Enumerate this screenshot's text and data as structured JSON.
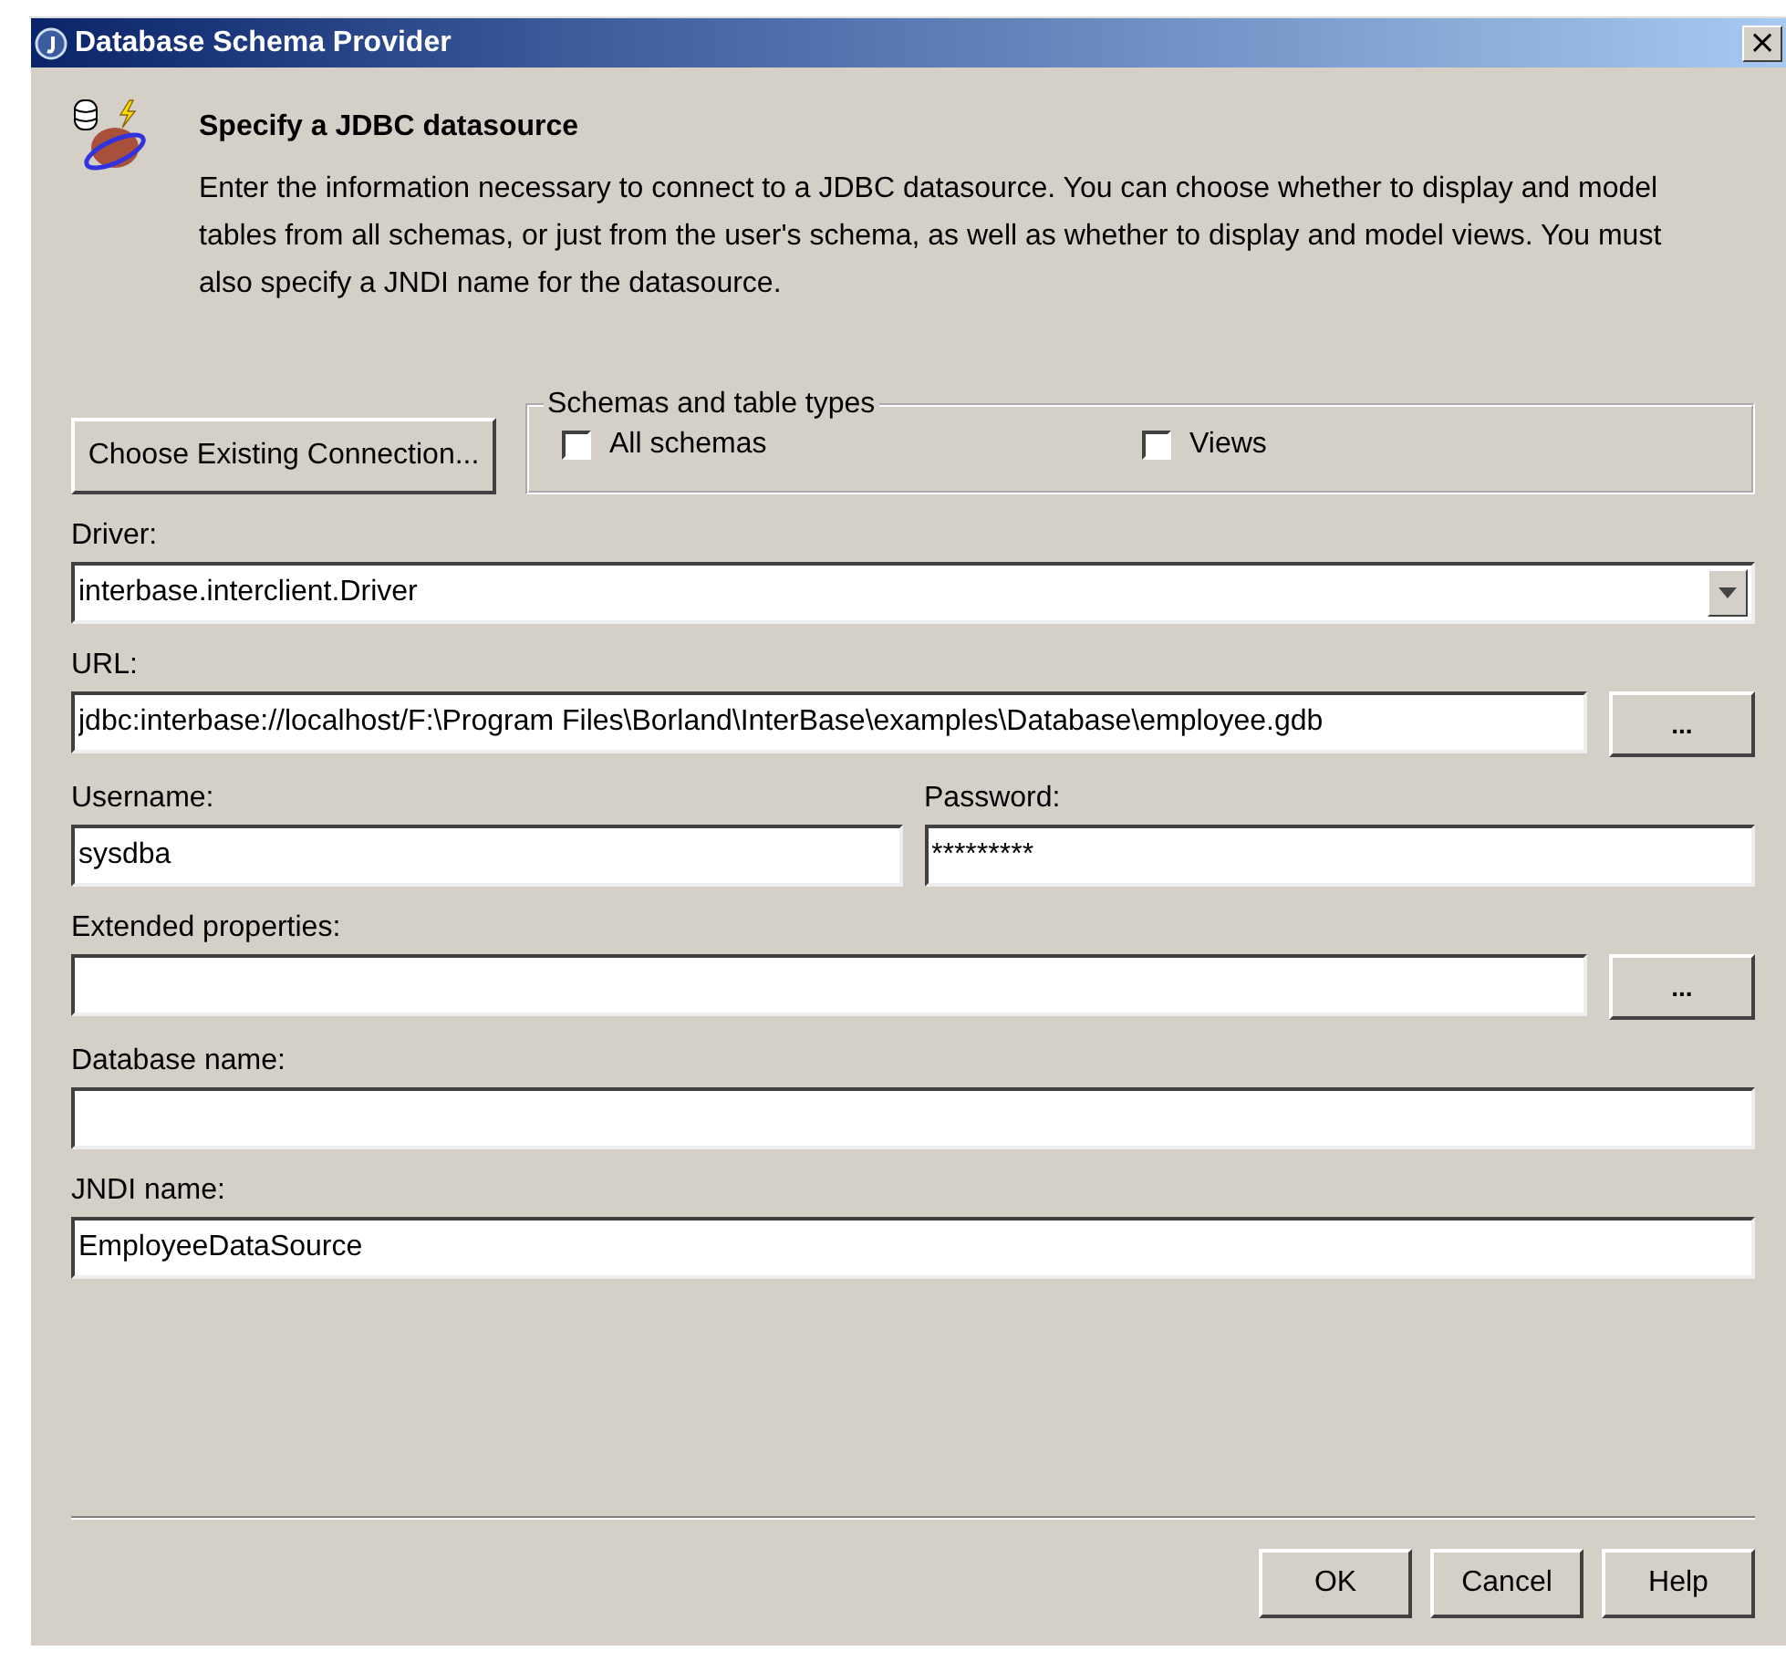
{
  "window": {
    "title": "Database Schema Provider",
    "close_label": "×"
  },
  "header": {
    "title": "Specify a JDBC datasource",
    "description": "Enter the information necessary to connect to a JDBC datasource. You can choose whether to display and model tables from all schemas, or just from the user's schema, as well as whether to display and model views.  You must also specify a JNDI name for the datasource."
  },
  "choose_button": "Choose Existing Connection...",
  "schemas_group": {
    "title": "Schemas and table types",
    "options": [
      {
        "label": "All schemas",
        "checked": false
      },
      {
        "label": "Views",
        "checked": false
      }
    ]
  },
  "driver": {
    "label": "Driver:",
    "value": "interbase.interclient.Driver"
  },
  "url": {
    "label": "URL:",
    "value": "jdbc:interbase://localhost/F:\\Program Files\\Borland\\InterBase\\examples\\Database\\employee.gdb",
    "button": "..."
  },
  "username": {
    "label": "Username:",
    "value": "sysdba"
  },
  "password": {
    "label": "Password:",
    "value": "*********"
  },
  "extended_properties": {
    "label": "Extended properties:",
    "button": "..."
  },
  "database_name": {
    "label": "Database name:"
  },
  "jndi_name": {
    "label": "JNDI name:",
    "value": "EmployeeDataSource"
  },
  "buttons": [
    "OK",
    "Cancel",
    "Help"
  ]
}
